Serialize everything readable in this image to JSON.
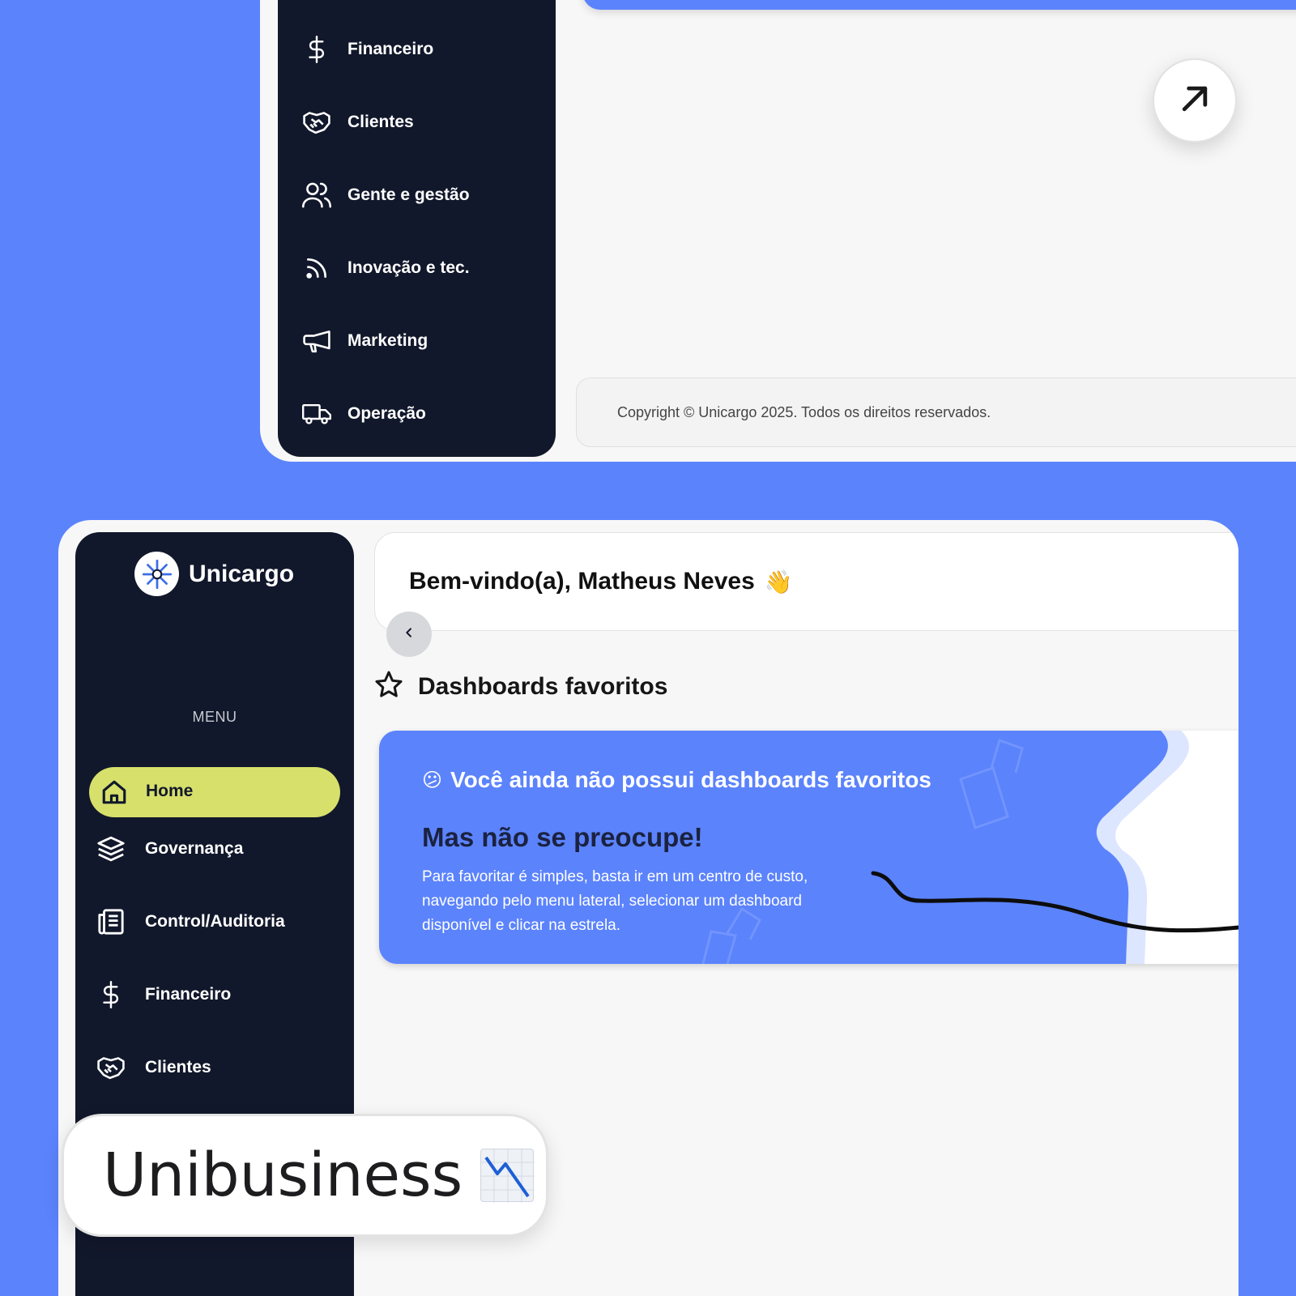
{
  "top_window": {
    "nav": [
      {
        "label": "Financeiro",
        "icon": "dollar-icon"
      },
      {
        "label": "Clientes",
        "icon": "handshake-icon"
      },
      {
        "label": "Gente e gestão",
        "icon": "users-icon"
      },
      {
        "label": "Inovação e tec.",
        "icon": "rss-icon"
      },
      {
        "label": "Marketing",
        "icon": "megaphone-icon"
      },
      {
        "label": "Operação",
        "icon": "truck-icon"
      }
    ],
    "footer": "Copyright © Unicargo 2025. Todos os direitos reservados."
  },
  "bottom_window": {
    "brand": "Unicargo",
    "menu_label": "MENU",
    "home_label": "Home",
    "nav": [
      {
        "label": "Governança",
        "icon": "layers-icon"
      },
      {
        "label": "Control/Auditoria",
        "icon": "newspaper-icon"
      },
      {
        "label": "Financeiro",
        "icon": "dollar-icon"
      },
      {
        "label": "Clientes",
        "icon": "handshake-icon"
      }
    ],
    "welcome": "Bem-vindo(a), Matheus Neves",
    "welcome_emoji": "👋",
    "favorites_title": "Dashboards favoritos",
    "card": {
      "emoji": "😕",
      "empty_message": "Você ainda não possui dashboards favoritos",
      "subhead": "Mas não se preocupe!",
      "description": "Para favoritar é simples, basta ir em um centro de custo, navegando pelo menu lateral, selecionar um dashboard disponível e clicar na estrela."
    }
  },
  "toast": {
    "text": "Unibusiness",
    "icon": "chart-decreasing-icon"
  },
  "colors": {
    "background": "#5b83fc",
    "sidebar": "#12182b",
    "home_pill": "#d6e06b",
    "card_blue": "#5b83fc"
  }
}
